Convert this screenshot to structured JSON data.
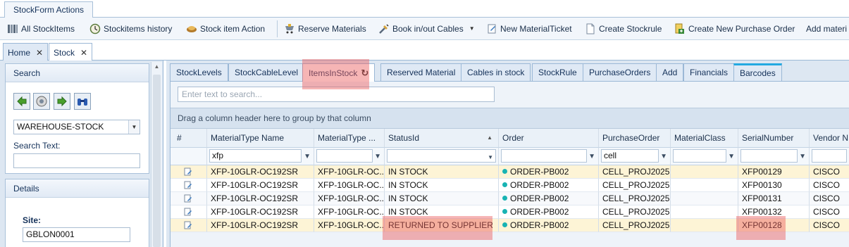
{
  "ribbon": {
    "tab_label": "StockForm Actions"
  },
  "toolbar": {
    "items": [
      {
        "label": "All StockItems",
        "icon": "list-icon"
      },
      {
        "label": "Stockitems history",
        "icon": "history-icon"
      },
      {
        "label": "Stock item Action",
        "icon": "action-icon"
      },
      {
        "label": "Reserve Materials",
        "icon": "reserve-icon"
      },
      {
        "label": "Book in/out Cables",
        "icon": "cable-icon"
      },
      {
        "label": "New MaterialTicket",
        "icon": "ticket-icon"
      },
      {
        "label": "Create Stockrule",
        "icon": "document-icon"
      },
      {
        "label": "Create New Purchase Order",
        "icon": "purchase-icon"
      },
      {
        "label": "Add materi",
        "icon": ""
      }
    ]
  },
  "doc_tabs": [
    {
      "label": "Home"
    },
    {
      "label": "Stock"
    }
  ],
  "search_panel": {
    "title": "Search",
    "warehouse_value": "WAREHOUSE-STOCK",
    "search_text_label": "Search Text:",
    "search_text_value": ""
  },
  "details_panel": {
    "title": "Details",
    "site_label": "Site:",
    "site_value": "GBLON0001"
  },
  "sub_tabs": [
    "StockLevels",
    "StockCableLevel",
    "ItemsInStock",
    "Reserved Material",
    "Cables in stock",
    "StockRule",
    "PurchaseOrders",
    "Add",
    "Financials",
    "Barcodes"
  ],
  "grid": {
    "search_placeholder": "Enter text to search...",
    "group_panel_text": "Drag a column header here to group by that column",
    "columns": [
      "#",
      "MaterialType Name",
      "MaterialType ...",
      "StatusId",
      "Order",
      "PurchaseOrder",
      "MaterialClass",
      "SerialNumber",
      "Vendor N"
    ],
    "filters": {
      "name": "xfp",
      "purchase_order": "cell"
    },
    "rows": [
      {
        "name": "XFP-10GLR-OC192SR",
        "type": "XFP-10GLR-OC...",
        "status": "IN STOCK",
        "order": "ORDER-PB002",
        "po": "CELL_PROJ2025",
        "class": "",
        "serial": "XFP00129",
        "vendor": "CISCO"
      },
      {
        "name": "XFP-10GLR-OC192SR",
        "type": "XFP-10GLR-OC...",
        "status": "IN STOCK",
        "order": "ORDER-PB002",
        "po": "CELL_PROJ2025",
        "class": "",
        "serial": "XFP00130",
        "vendor": "CISCO"
      },
      {
        "name": "XFP-10GLR-OC192SR",
        "type": "XFP-10GLR-OC...",
        "status": "IN STOCK",
        "order": "ORDER-PB002",
        "po": "CELL_PROJ2025",
        "class": "",
        "serial": "XFP00131",
        "vendor": "CISCO"
      },
      {
        "name": "XFP-10GLR-OC192SR",
        "type": "XFP-10GLR-OC...",
        "status": "IN STOCK",
        "order": "ORDER-PB002",
        "po": "CELL_PROJ2025",
        "class": "",
        "serial": "XFP00132",
        "vendor": "CISCO"
      },
      {
        "name": "XFP-10GLR-OC192SR",
        "type": "XFP-10GLR-OC...",
        "status": "RETURNED TO SUPPLIER",
        "order": "ORDER-PB002",
        "po": "CELL_PROJ2025",
        "class": "",
        "serial": "XFP00128",
        "vendor": "CISCO"
      }
    ]
  },
  "colors": {
    "highlight": "#eb5a5a",
    "order_dot": "#17b3b3",
    "selected_row": "#fdf4d6",
    "barcodes_accent": "#23a9e1"
  }
}
